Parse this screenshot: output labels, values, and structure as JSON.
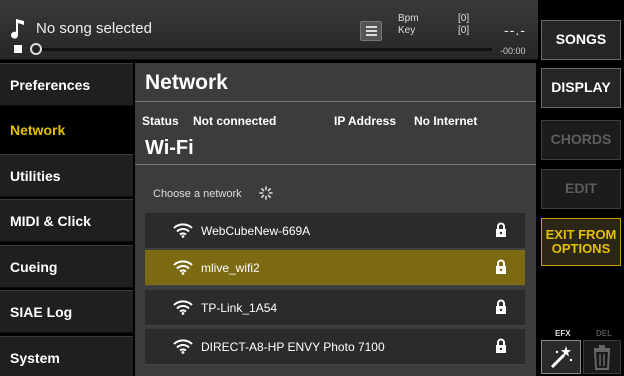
{
  "player": {
    "song_title": "No song selected",
    "bpm_label": "Bpm",
    "bpm_value": "[0]",
    "key_label": "Key",
    "key_value": "[0]",
    "time_display": "--.-",
    "time_remaining": "-00:00",
    "progress": 0
  },
  "right_buttons": {
    "songs": "SONGS",
    "display": "DISPLAY",
    "chords": "CHORDS",
    "edit": "EDIT",
    "exit_line1": "EXIT FROM",
    "exit_line2": "OPTIONS",
    "efx_label": "EFX",
    "del_label": "DEL"
  },
  "sidebar": {
    "items": [
      {
        "label": "Preferences"
      },
      {
        "label": "Network"
      },
      {
        "label": "Utilities"
      },
      {
        "label": "MIDI & Click"
      },
      {
        "label": "Cueing"
      },
      {
        "label": "SIAE Log"
      },
      {
        "label": "System"
      }
    ],
    "active": "Network"
  },
  "main": {
    "title": "Network",
    "status_label": "Status",
    "status_value": "Not connected",
    "ip_label": "IP Address",
    "ip_value": "No Internet",
    "wifi_title": "Wi-Fi",
    "choose_label": "Choose a network",
    "networks": [
      {
        "ssid": "WebCubeNew-669A"
      },
      {
        "ssid": "mlive_wifi2"
      },
      {
        "ssid": "TP-Link_1A54"
      },
      {
        "ssid": "DIRECT-A8-HP ENVY Photo 7100"
      }
    ],
    "selected_network": "mlive_wifi2"
  },
  "colors": {
    "accent": "#e4c000",
    "selected_row": "#7c6a12",
    "panel": "#3c3c3c"
  },
  "icons": {
    "note": "music-note-icon",
    "list": "list-icon",
    "wifi": "wifi-icon",
    "lock": "lock-icon",
    "spinner": "loading-spinner-icon",
    "efx": "magic-wand-icon",
    "del": "trash-icon"
  }
}
